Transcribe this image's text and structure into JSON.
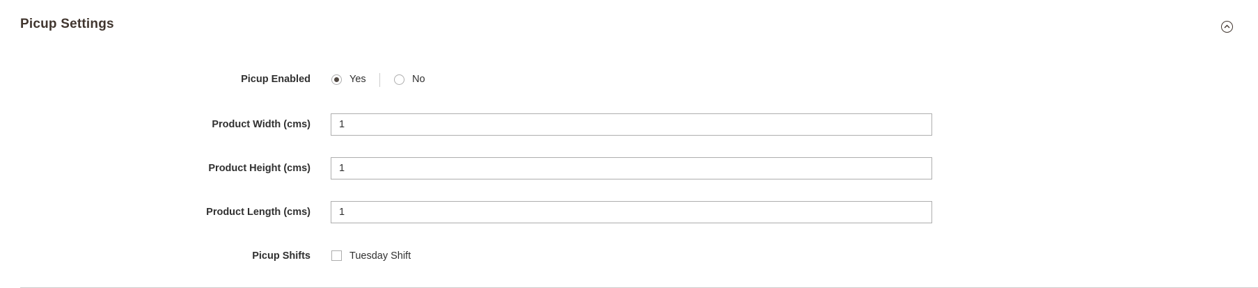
{
  "section": {
    "title": "Picup Settings",
    "collapse_icon": "chevron-up-circle-icon"
  },
  "fields": {
    "picup_enabled": {
      "label": "Picup Enabled",
      "options": [
        {
          "label": "Yes",
          "checked": true
        },
        {
          "label": "No",
          "checked": false
        }
      ]
    },
    "product_width": {
      "label": "Product Width (cms)",
      "value": "1"
    },
    "product_height": {
      "label": "Product Height (cms)",
      "value": "1"
    },
    "product_length": {
      "label": "Product Length (cms)",
      "value": "1"
    },
    "picup_shifts": {
      "label": "Picup Shifts",
      "options": [
        {
          "label": "Tuesday Shift",
          "checked": false
        }
      ]
    }
  }
}
